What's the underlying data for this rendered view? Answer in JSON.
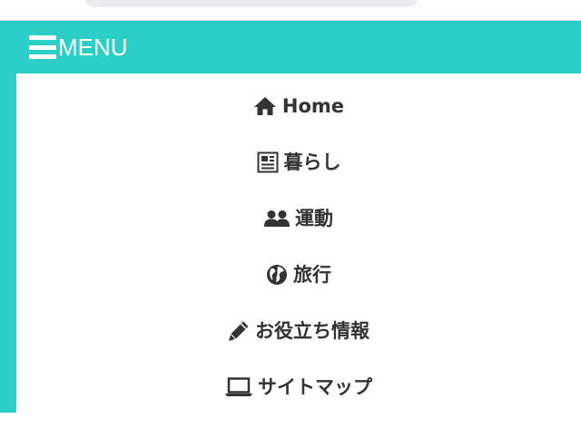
{
  "header": {
    "menu_label": "MENU"
  },
  "nav": {
    "items": [
      {
        "label": "Home",
        "icon": "home-icon"
      },
      {
        "label": "暮らし",
        "icon": "newspaper-icon"
      },
      {
        "label": "運動",
        "icon": "users-icon"
      },
      {
        "label": "旅行",
        "icon": "globe-icon"
      },
      {
        "label": "お役立ち情報",
        "icon": "pencil-icon"
      },
      {
        "label": "サイトマップ",
        "icon": "laptop-icon"
      }
    ]
  },
  "colors": {
    "accent": "#2ccfc7",
    "text": "#333333",
    "background": "#ffffff"
  }
}
